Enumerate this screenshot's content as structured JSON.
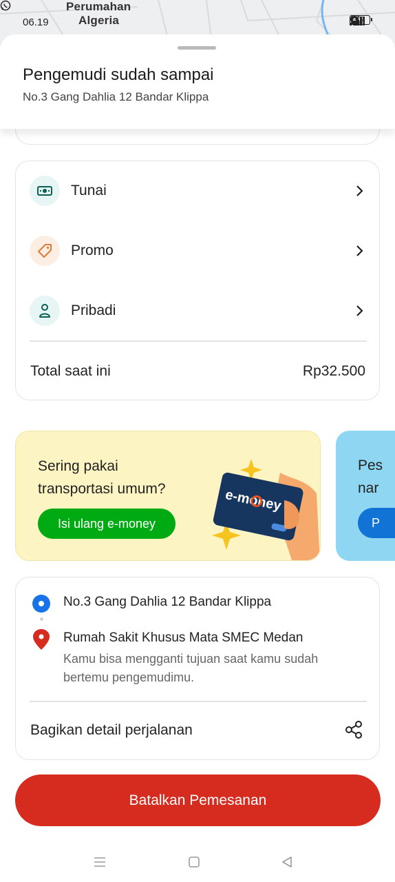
{
  "status_bar": {
    "time": "06.19",
    "battery": "70",
    "network": "4G"
  },
  "map": {
    "label_line1": "Perumahan",
    "label_line2": "Algeria"
  },
  "header": {
    "title": "Pengemudi sudah sampai",
    "address": "No.3 Gang Dahlia 12 Bandar Klippa"
  },
  "payment": {
    "items": [
      {
        "label": "Tunai",
        "icon": "cash-icon"
      },
      {
        "label": "Promo",
        "icon": "tag-icon"
      },
      {
        "label": "Pribadi",
        "icon": "person-icon"
      }
    ],
    "total_label": "Total saat ini",
    "total_value": "Rp32.500"
  },
  "banners": [
    {
      "text_line1": "Sering pakai",
      "text_line2": "transportasi umum?",
      "button": "Isi ulang e-money",
      "card_brand": "e-money"
    },
    {
      "text_line1": "Pes",
      "text_line2": "nar",
      "button": "P"
    }
  ],
  "trip": {
    "pickup": "No.3 Gang Dahlia 12 Bandar Klippa",
    "destination": "Rumah Sakit Khusus Mata SMEC Medan",
    "note": "Kamu bisa mengganti tujuan saat kamu sudah bertemu pengemudimu.",
    "share_label": "Bagikan detail perjalanan"
  },
  "cancel_button": "Batalkan Pemesanan",
  "colors": {
    "green": "#00aa13",
    "red": "#d62b1f",
    "blue": "#1873e8",
    "banner_yellow": "#fdf4c3"
  }
}
